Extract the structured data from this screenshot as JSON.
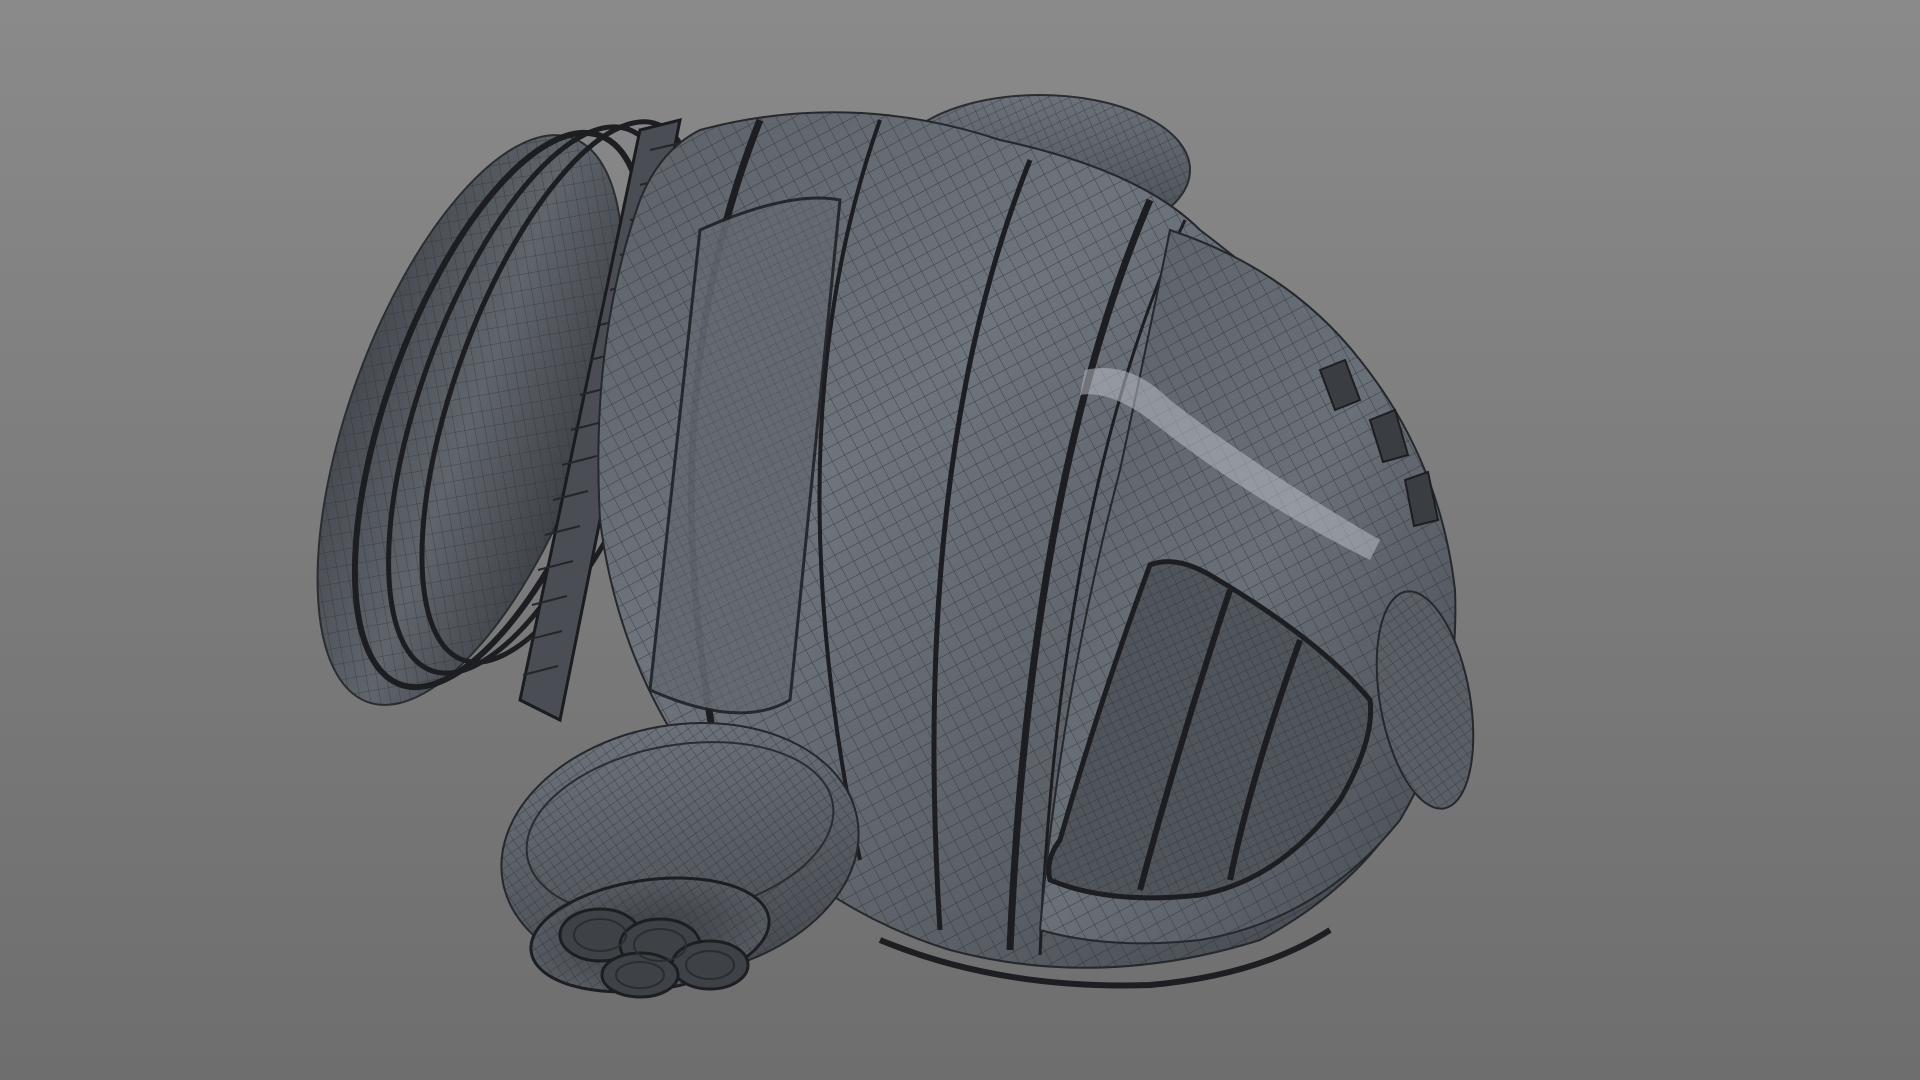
{
  "viewport": {
    "background_top": "#8a8a8a",
    "background_bottom": "#6e6e6e"
  },
  "model": {
    "description_icon": "wireframe-capsule-model",
    "surface_color": "#5a5f66",
    "surface_dark": "#3d4146",
    "surface_light": "#8a9098",
    "wire_color": "#2a2d31",
    "groove_color": "#1c1e21"
  }
}
